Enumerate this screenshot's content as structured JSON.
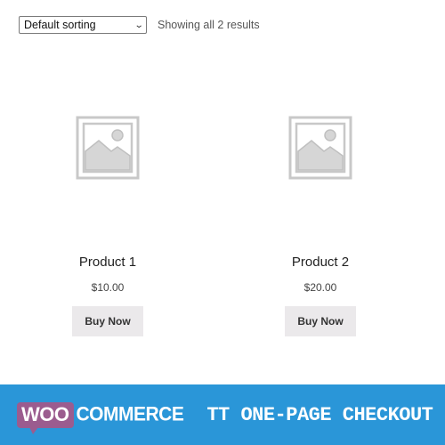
{
  "sorting": {
    "selected": "Default sorting",
    "icon": "chevron-down-icon"
  },
  "result_count": "Showing all 2 results",
  "products": [
    {
      "title": "Product 1",
      "price": "$10.00",
      "button": "Buy Now",
      "image_icon": "image-placeholder-icon"
    },
    {
      "title": "Product 2",
      "price": "$20.00",
      "button": "Buy Now",
      "image_icon": "image-placeholder-icon"
    }
  ],
  "banner": {
    "logo_woo": "WOO",
    "logo_commerce": "COMMERCE",
    "title": "TT ONE-PAGE CHECKOUT",
    "colors": {
      "background": "#2a96d8",
      "woo_purple": "#9b5c8f"
    }
  }
}
